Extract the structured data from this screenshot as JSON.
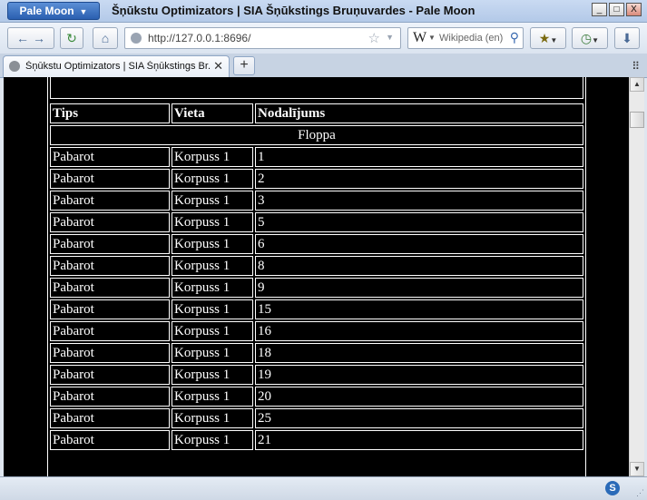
{
  "browser": {
    "app_menu_label": "Pale Moon",
    "window_title": "Šņūkstu Optimizators | SIA Šņūkstings Bruņuvardes - Pale Moon",
    "url": "http://127.0.0.1:8696/",
    "search_engine": "Wikipedia (en)",
    "tab_title": "Šņūkstu Optimizators | SIA Šņūkstings Br...",
    "window_buttons": {
      "minimize": "_",
      "maximize": "□",
      "close": "X"
    }
  },
  "table": {
    "headers": [
      "Tips",
      "Vieta",
      "Nodalījums"
    ],
    "group": "Floppa",
    "rows": [
      [
        "Pabarot",
        "Korpuss 1",
        "1"
      ],
      [
        "Pabarot",
        "Korpuss 1",
        "2"
      ],
      [
        "Pabarot",
        "Korpuss 1",
        "3"
      ],
      [
        "Pabarot",
        "Korpuss 1",
        "5"
      ],
      [
        "Pabarot",
        "Korpuss 1",
        "6"
      ],
      [
        "Pabarot",
        "Korpuss 1",
        "8"
      ],
      [
        "Pabarot",
        "Korpuss 1",
        "9"
      ],
      [
        "Pabarot",
        "Korpuss 1",
        "15"
      ],
      [
        "Pabarot",
        "Korpuss 1",
        "16"
      ],
      [
        "Pabarot",
        "Korpuss 1",
        "18"
      ],
      [
        "Pabarot",
        "Korpuss 1",
        "19"
      ],
      [
        "Pabarot",
        "Korpuss 1",
        "20"
      ],
      [
        "Pabarot",
        "Korpuss 1",
        "25"
      ],
      [
        "Pabarot",
        "Korpuss 1",
        "21"
      ]
    ]
  },
  "colors": {
    "page_background": "#000000",
    "text": "#ffffff",
    "chrome": "#dfe6ef",
    "accent": "#2a5fb0"
  }
}
